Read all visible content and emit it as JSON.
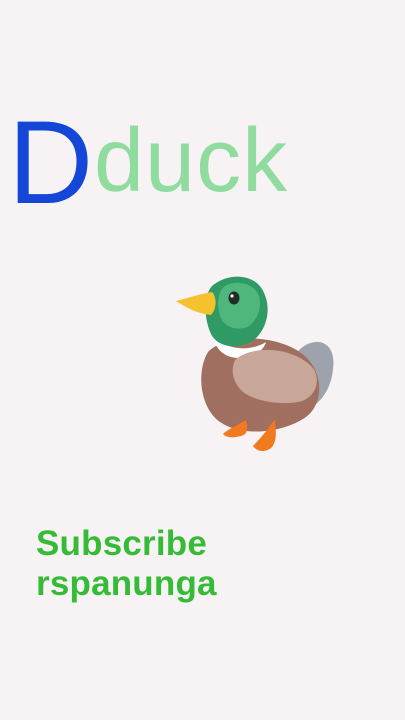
{
  "card": {
    "letter": "D",
    "word": "duck",
    "icon": "duck-icon"
  },
  "footer": {
    "line1": "Subscribe",
    "line2": "rspanunga"
  },
  "colors": {
    "background": "#f7f2f4",
    "letter": "#1446d8",
    "word": "#8fdc9e",
    "footer": "#36bb37"
  }
}
